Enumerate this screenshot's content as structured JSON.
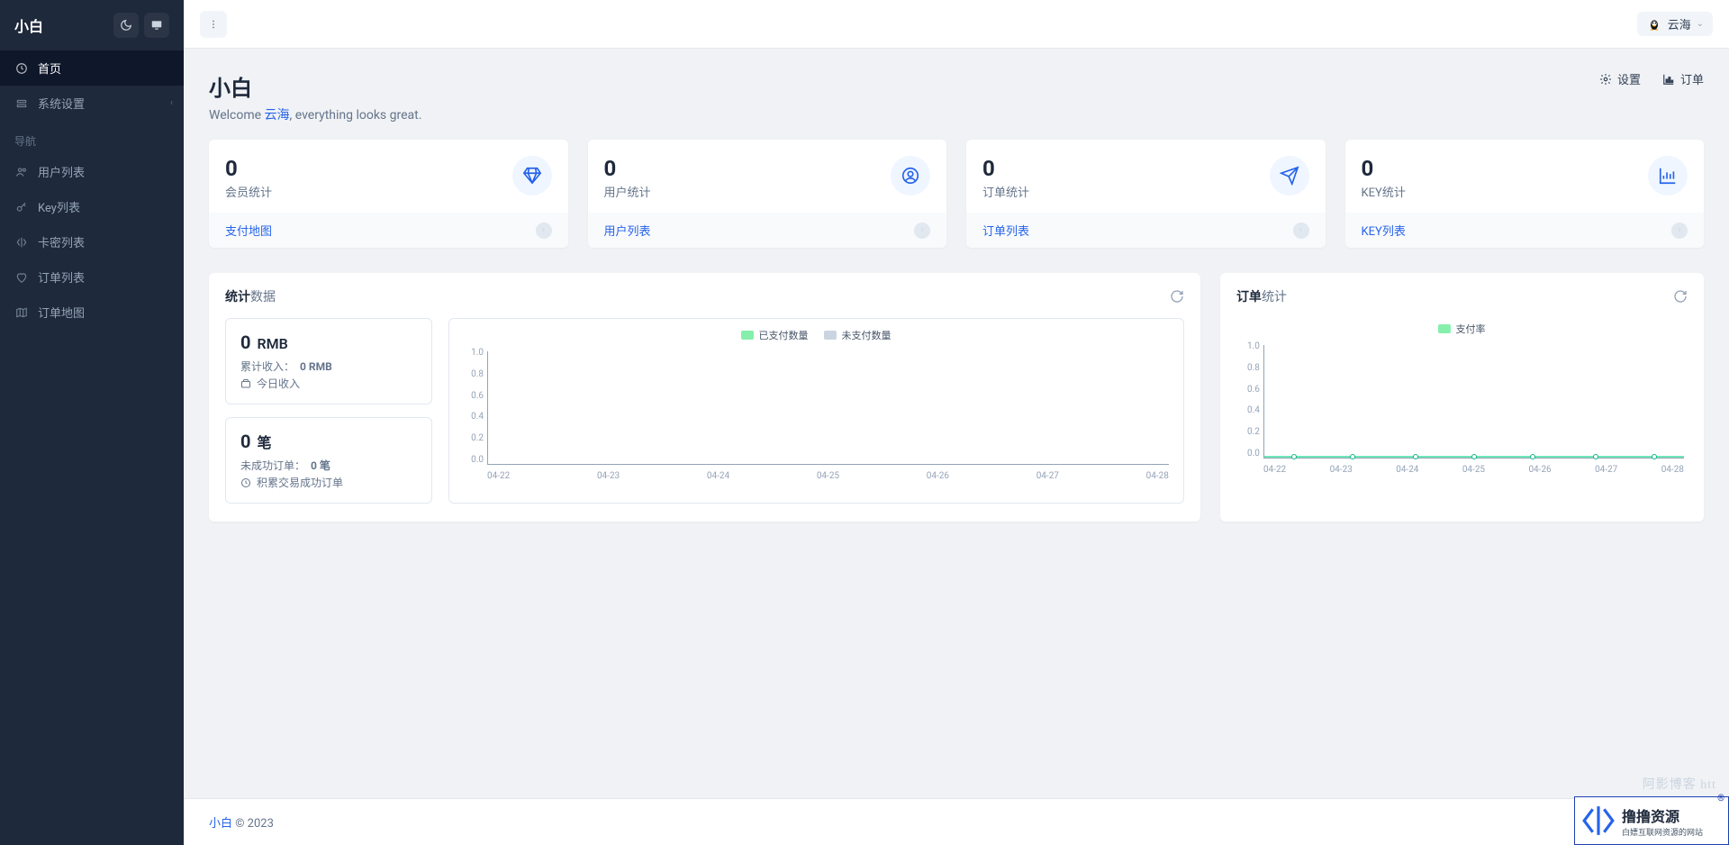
{
  "brand": "小白",
  "sidebar": {
    "items": [
      {
        "label": "首页",
        "icon": "dashboard"
      },
      {
        "label": "系统设置",
        "icon": "settings",
        "expandable": true
      }
    ],
    "nav_title": "导航",
    "nav_items": [
      {
        "label": "用户列表",
        "icon": "users"
      },
      {
        "label": "Key列表",
        "icon": "key"
      },
      {
        "label": "卡密列表",
        "icon": "card"
      },
      {
        "label": "订单列表",
        "icon": "heart"
      },
      {
        "label": "订单地图",
        "icon": "map"
      }
    ]
  },
  "topbar": {
    "user": "云海"
  },
  "page": {
    "title": "小白",
    "welcome_pre": "Welcome ",
    "welcome_name": "云海",
    "welcome_post": ", everything looks great.",
    "link_settings": "设置",
    "link_orders": "订单"
  },
  "stats": [
    {
      "value": "0",
      "label": "会员统计",
      "link": "支付地图",
      "icon": "diamond"
    },
    {
      "value": "0",
      "label": "用户统计",
      "link": "用户列表",
      "icon": "user"
    },
    {
      "value": "0",
      "label": "订单统计",
      "link": "订单列表",
      "icon": "send"
    },
    {
      "value": "0",
      "label": "KEY统计",
      "link": "KEY列表",
      "icon": "chart"
    }
  ],
  "panel_stats": {
    "title_bold": "统计",
    "title_rest": "数据",
    "card1": {
      "value": "0",
      "unit": "RMB",
      "line1_pre": "累计收入：",
      "line1_val": "0 RMB",
      "line2": "今日收入"
    },
    "card2": {
      "value": "0",
      "unit": "笔",
      "line1_pre": "未成功订单：",
      "line1_val": "0 笔",
      "line2": "积累交易成功订单"
    }
  },
  "panel_orders": {
    "title_bold": "订单",
    "title_rest": "统计"
  },
  "chart_data": [
    {
      "type": "line",
      "title": "",
      "series": [
        {
          "name": "已支付数量",
          "color": "#86efac",
          "values": [
            0,
            0,
            0,
            0,
            0,
            0,
            0
          ]
        },
        {
          "name": "未支付数量",
          "color": "#cbd5e1",
          "values": [
            0,
            0,
            0,
            0,
            0,
            0,
            0
          ]
        }
      ],
      "categories": [
        "04-22",
        "04-23",
        "04-24",
        "04-25",
        "04-26",
        "04-27",
        "04-28"
      ],
      "y_ticks": [
        "1.0",
        "0.8",
        "0.6",
        "0.4",
        "0.2",
        "0.0"
      ],
      "ylim": [
        0,
        1
      ]
    },
    {
      "type": "line",
      "title": "",
      "series": [
        {
          "name": "支付率",
          "color": "#86efac",
          "values": [
            0,
            0,
            0,
            0,
            0,
            0,
            0
          ]
        }
      ],
      "categories": [
        "04-22",
        "04-23",
        "04-24",
        "04-25",
        "04-26",
        "04-27",
        "04-28"
      ],
      "y_ticks": [
        "1.0",
        "0.8",
        "0.6",
        "0.4",
        "0.2",
        "0.0"
      ],
      "ylim": [
        0,
        1
      ]
    }
  ],
  "footer": {
    "brand": "小白",
    "rest": " © 2023"
  },
  "watermark": "阿影博客 htt",
  "badge": {
    "line1": "撸撸资源",
    "line2": "白嫖互联网资源的网站"
  }
}
